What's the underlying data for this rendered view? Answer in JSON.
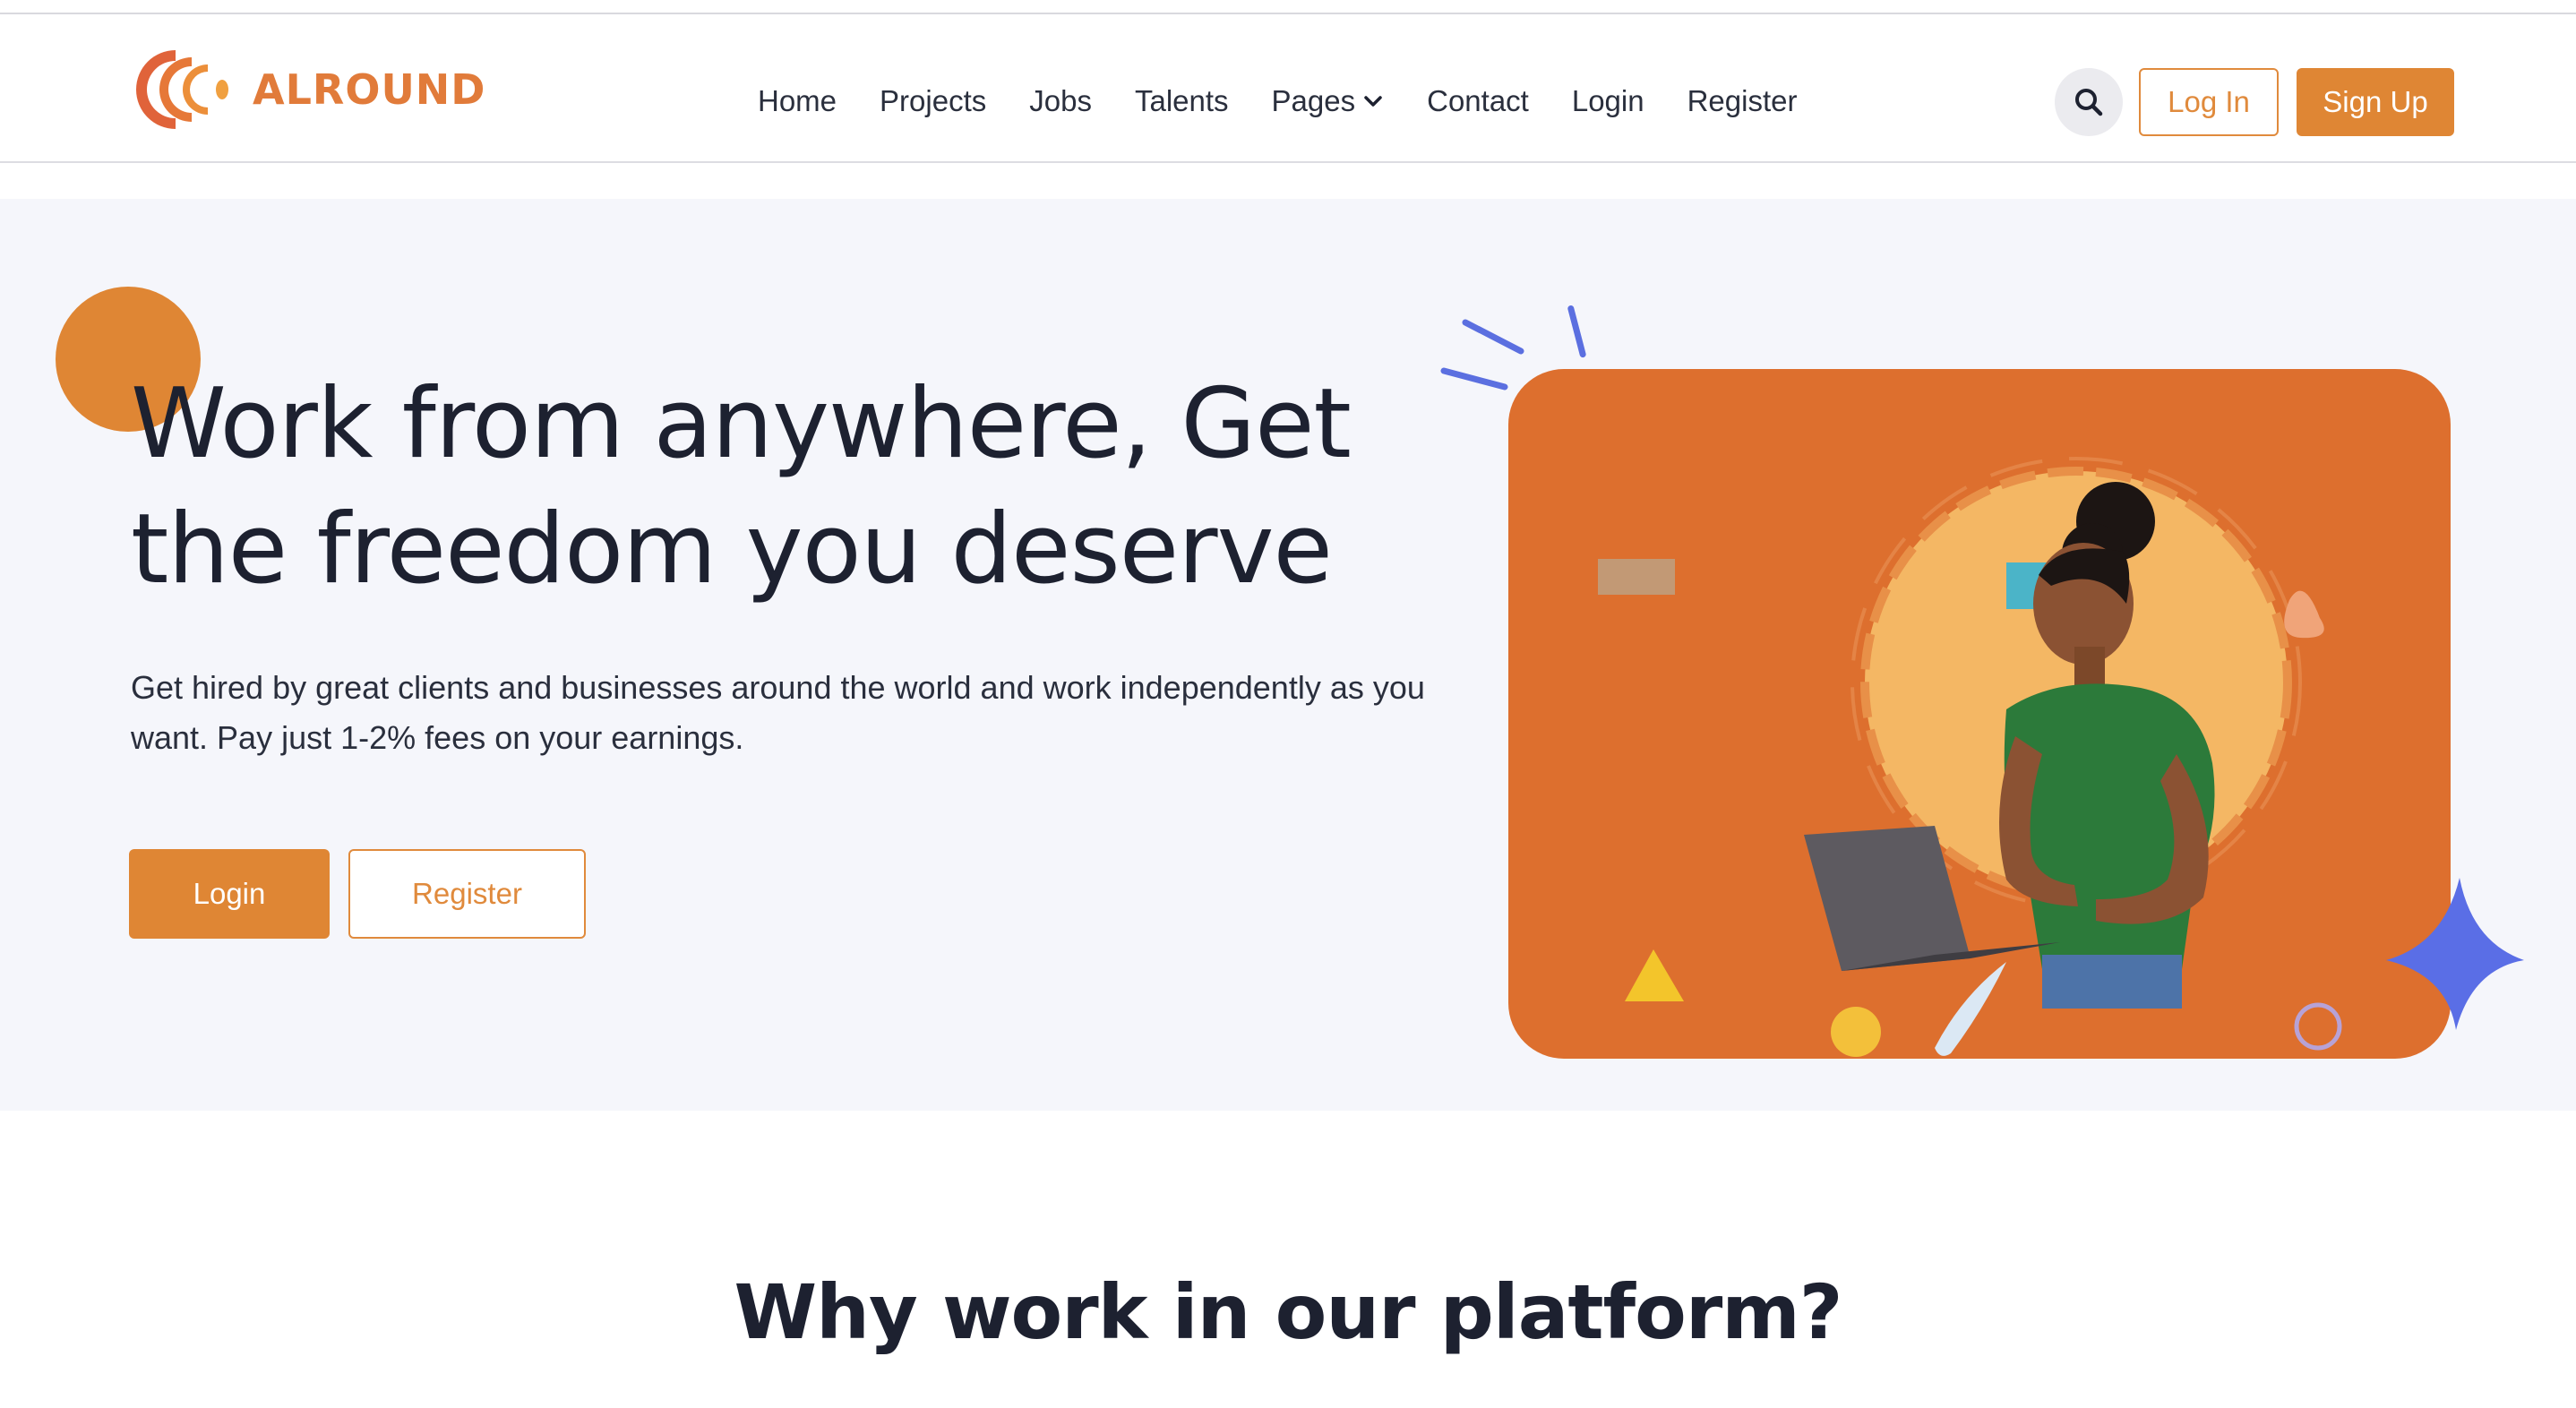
{
  "brand": {
    "name": "ALROUND",
    "accent_color": "#df8634"
  },
  "nav": {
    "items": [
      {
        "label": "Home"
      },
      {
        "label": "Projects"
      },
      {
        "label": "Jobs"
      },
      {
        "label": "Talents"
      },
      {
        "label": "Pages"
      },
      {
        "label": "Contact"
      },
      {
        "label": "Login"
      },
      {
        "label": "Register"
      }
    ],
    "search_icon": "search-icon",
    "login_label": "Log In",
    "signup_label": "Sign Up"
  },
  "hero": {
    "title": "Work from anywhere, Get the freedom you deserve",
    "subtitle": "Get hired by great clients and businesses around the world and work independently as you want. Pay just 1-2% fees on your earnings.",
    "primary_label": "Login",
    "secondary_label": "Register",
    "card_color": "#dd6f2e"
  },
  "section": {
    "title": "Why work in our platform?"
  }
}
